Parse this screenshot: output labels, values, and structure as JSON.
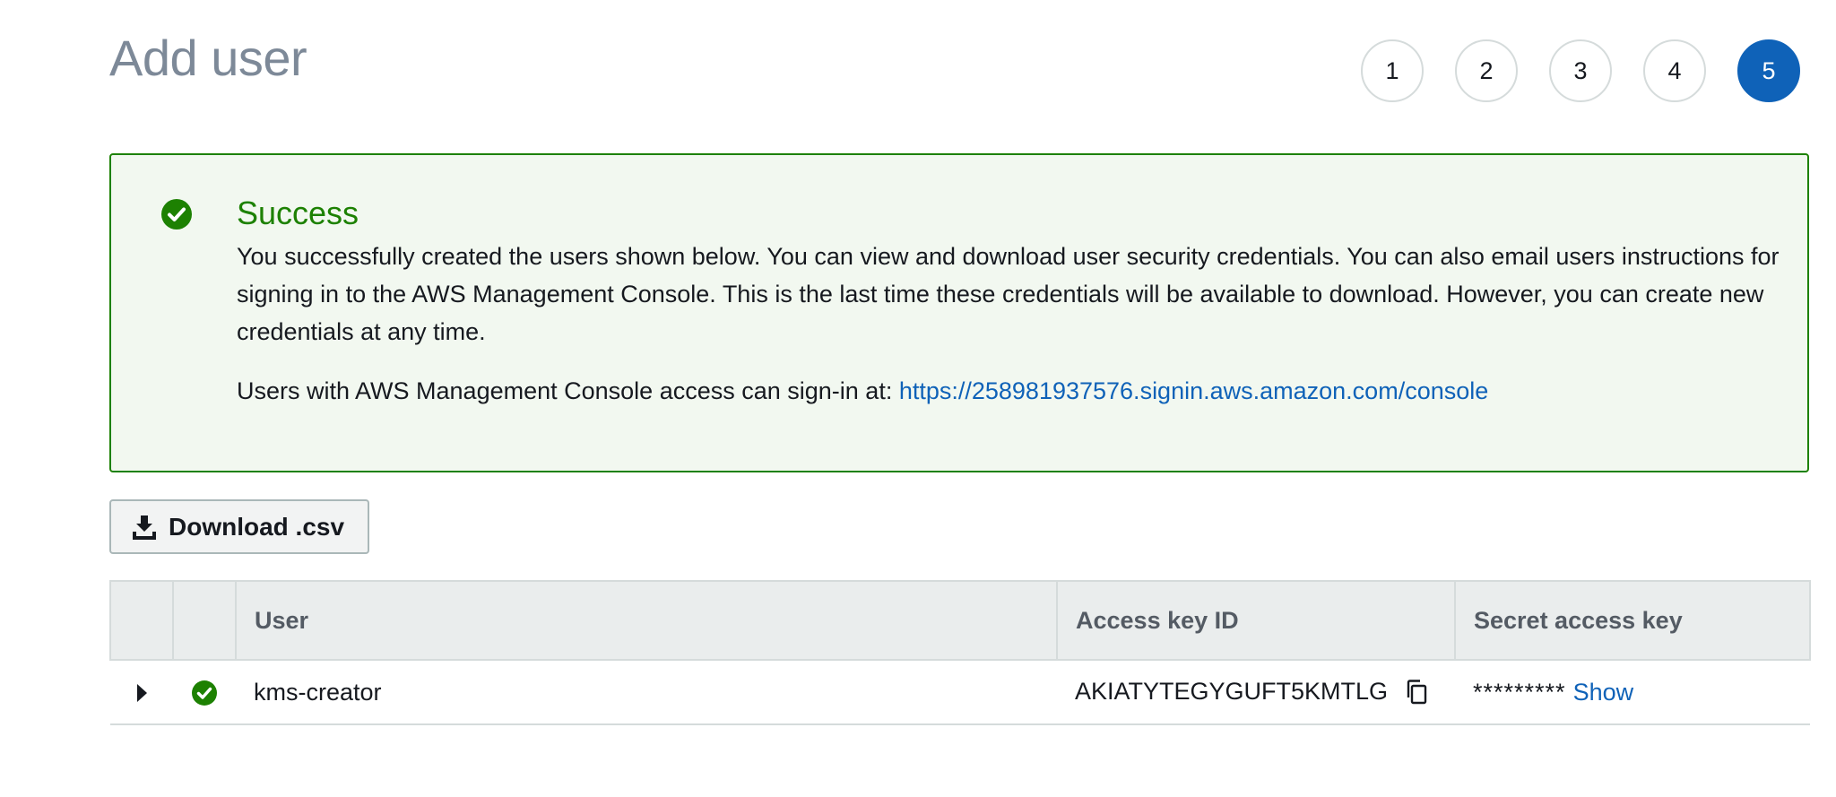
{
  "page": {
    "title": "Add user"
  },
  "steps": [
    "1",
    "2",
    "3",
    "4",
    "5"
  ],
  "active_step": "5",
  "alert": {
    "title": "Success",
    "body": "You successfully created the users shown below. You can view and download user security credentials. You can also email users instructions for signing in to the AWS Management Console. This is the last time these credentials will be available to download. However, you can create new credentials at any time.",
    "signin_prefix": "Users with AWS Management Console access can sign-in at: ",
    "signin_url": "https://258981937576.signin.aws.amazon.com/console",
    "color": "#1d8102"
  },
  "toolbar": {
    "download_label": "Download .csv"
  },
  "table": {
    "columns": [
      "User",
      "Access key ID",
      "Secret access key"
    ],
    "rows": [
      {
        "user": "kms-creator",
        "access_key_id": "AKIATYTEGYGUFT5KMTLG",
        "secret_masked": "*********",
        "secret_show_label": "Show"
      }
    ]
  },
  "colors": {
    "accent": "#0f62b8",
    "success": "#1d8102"
  },
  "icons": {
    "alert": "check-circle-icon",
    "download": "download-icon",
    "expand": "caret-right-icon",
    "row_status": "check-circle-icon",
    "copy": "copy-icon"
  }
}
